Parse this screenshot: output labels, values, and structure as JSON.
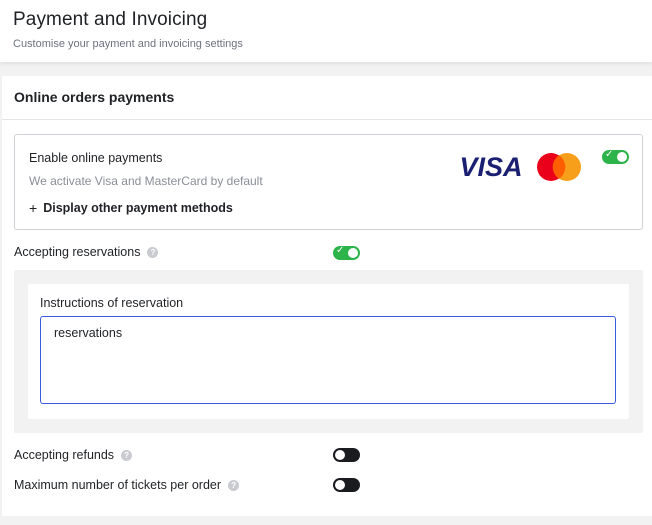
{
  "header": {
    "title": "Payment and Invoicing",
    "subtitle": "Customise your payment and invoicing settings"
  },
  "section": {
    "title": "Online orders payments"
  },
  "online_payments": {
    "title": "Enable online payments",
    "description": "We activate Visa and MasterCard by default",
    "more_methods_label": "Display other payment methods",
    "enabled": true,
    "visa_text": "VISA",
    "visa_color": "#1a1f71",
    "mastercard_colors": [
      "#eb001b",
      "#f79e1b"
    ]
  },
  "reservations": {
    "label": "Accepting reservations",
    "help": "?",
    "enabled": true,
    "instructions_label": "Instructions of reservation",
    "instructions_value": "reservations"
  },
  "refunds": {
    "label": "Accepting refunds",
    "help": "?",
    "enabled": false
  },
  "max_tickets": {
    "label": "Maximum number of tickets per order",
    "help": "?",
    "enabled": false
  },
  "colors": {
    "toggle_on": "#2cb34a",
    "toggle_off": "#1a1b1f",
    "focus_border": "#3b5bdb"
  }
}
